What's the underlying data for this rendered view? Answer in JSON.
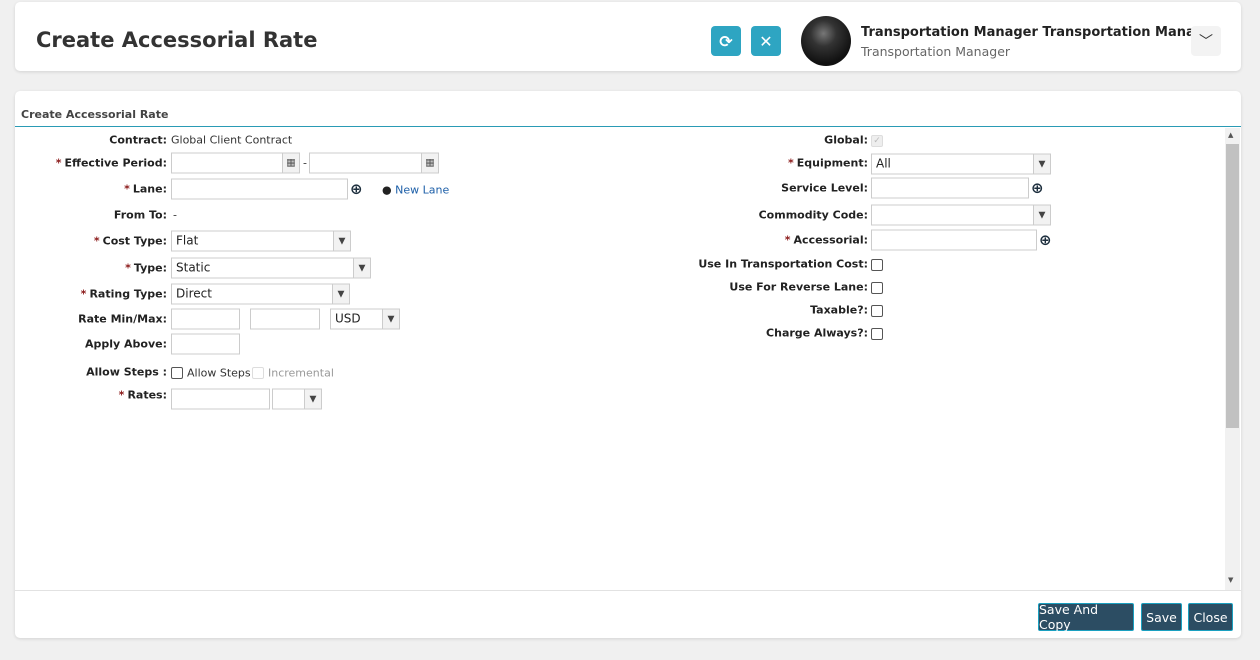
{
  "header": {
    "title": "Create Accessorial Rate",
    "refresh_icon": "refresh-icon",
    "close_icon": "close-icon",
    "user_name": "Transportation Manager Transportation Mana...",
    "user_role": "Transportation Manager"
  },
  "section": {
    "title": "Create Accessorial Rate"
  },
  "left": {
    "contract_label": "Contract:",
    "contract_value": "Global Client Contract",
    "effective_label": "Effective Period:",
    "effective_sep": "-",
    "lane_label": "Lane:",
    "new_lane": "New Lane",
    "fromto_label": "From To:",
    "fromto_value": "-",
    "cost_type_label": "Cost Type:",
    "cost_type_value": "Flat",
    "type_label": "Type:",
    "type_value": "Static",
    "rating_type_label": "Rating Type:",
    "rating_type_value": "Direct",
    "rate_minmax_label": "Rate Min/Max:",
    "currency_value": "USD",
    "apply_above_label": "Apply Above:",
    "allow_steps_label": "Allow Steps :",
    "allow_steps_cb": "Allow Steps",
    "incremental_cb": "Incremental",
    "rates_label": "Rates:"
  },
  "right": {
    "global_label": "Global:",
    "equipment_label": "Equipment:",
    "equipment_value": "All",
    "service_level_label": "Service Level:",
    "commodity_label": "Commodity Code:",
    "accessorial_label": "Accessorial:",
    "use_in_tc_label": "Use In Transportation Cost:",
    "reverse_lane_label": "Use For Reverse Lane:",
    "taxable_label": "Taxable?:",
    "charge_always_label": "Charge Always?:"
  },
  "footer": {
    "save_copy": "Save And Copy",
    "save": "Save",
    "close": "Close"
  },
  "required_mark": "*"
}
